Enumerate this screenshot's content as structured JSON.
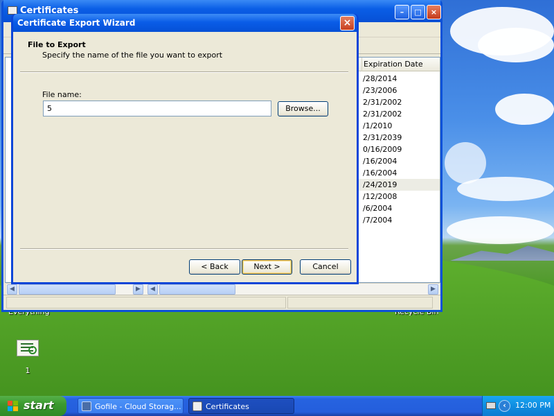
{
  "background_window": {
    "title": "Certificates",
    "column_header": "Expiration Date",
    "rows": [
      "/28/2014",
      "/23/2006",
      "2/31/2002",
      "2/31/2002",
      "/1/2010",
      "2/31/2039",
      "0/16/2009",
      "/16/2004",
      "/16/2004",
      "/24/2019",
      "/12/2008",
      "/6/2004",
      "/7/2004"
    ],
    "selected_row_index": 9,
    "status_left": "Everything",
    "status_right": "Recycle Bin"
  },
  "wizard": {
    "title": "Certificate Export Wizard",
    "header_title": "File to Export",
    "header_subtitle": "Specify the name of the file you want to export",
    "file_name_label": "File name:",
    "file_name_value": "5",
    "browse_label": "Browse...",
    "back_label": "< Back",
    "next_label": "Next >",
    "cancel_label": "Cancel"
  },
  "desktop": {
    "icon_label": "1"
  },
  "taskbar": {
    "start_label": "start",
    "tasks": [
      {
        "label": "Gofile - Cloud Storag...",
        "active": false
      },
      {
        "label": "Certificates",
        "active": true
      }
    ],
    "clock": "12:00 PM"
  },
  "colors": {
    "xp_blue": "#0a5de8",
    "taskbar": "#245edc",
    "start_green": "#3c9a2f",
    "dialog_face": "#ece9d8"
  }
}
